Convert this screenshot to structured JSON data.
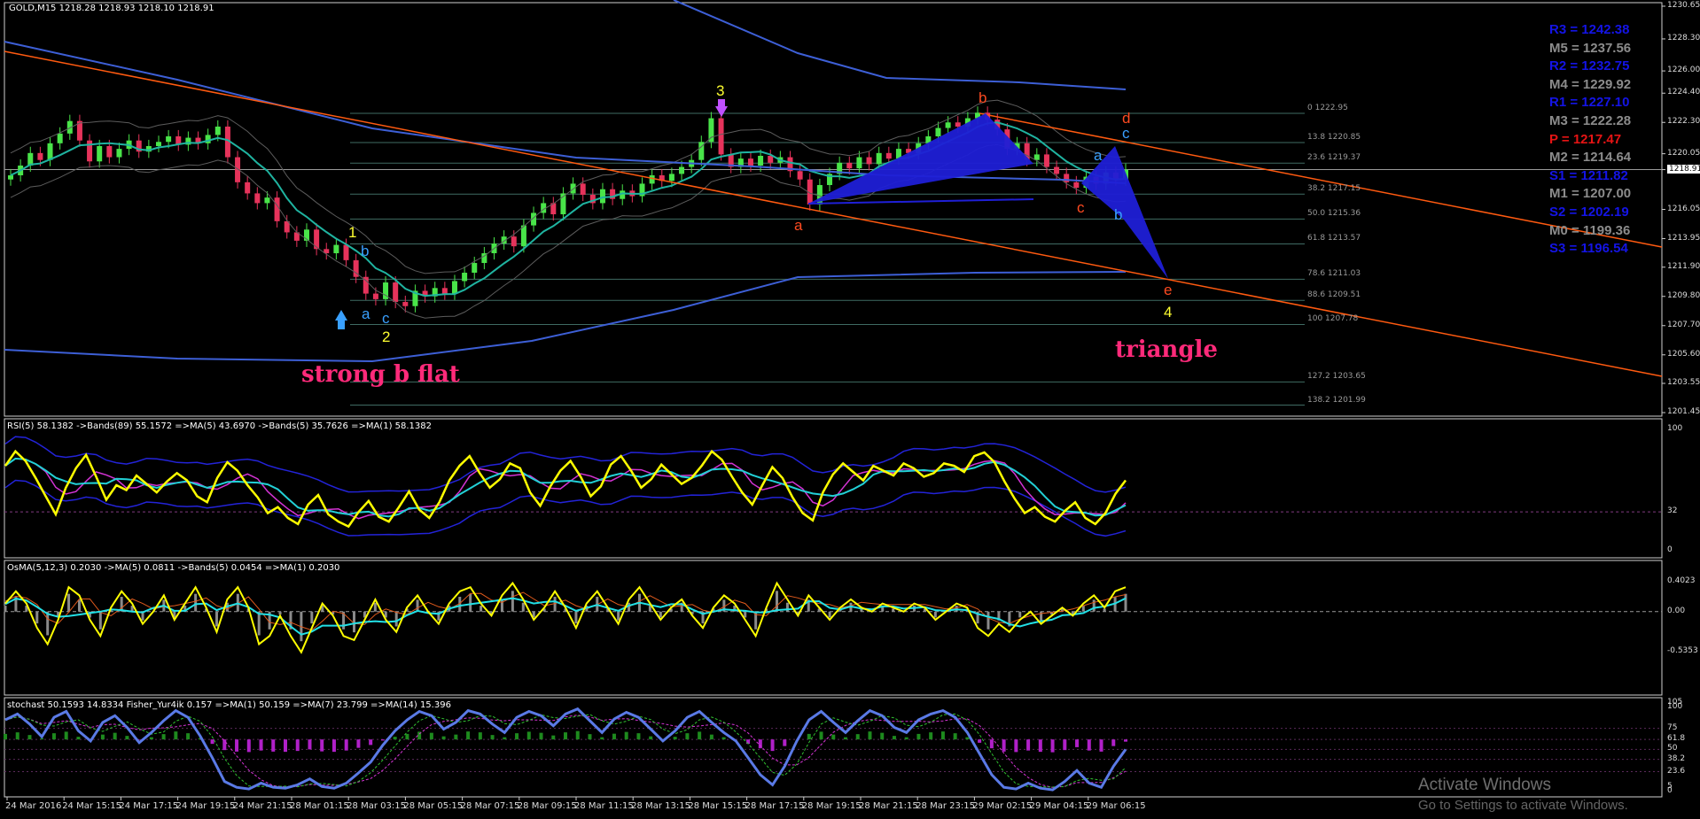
{
  "chart_data": {
    "type": "line",
    "symbol": "GOLD,M15",
    "header_prices": "1218.28 1218.93 1218.10 1218.91",
    "current_price": "1218.91",
    "price_axis": [
      "1230.65",
      "1228.30",
      "1226.00",
      "1224.40",
      "1222.30",
      "1220.05",
      "1218.91",
      "1216.05",
      "1213.95",
      "1211.90",
      "1209.80",
      "1207.70",
      "1205.60",
      "1203.55",
      "1201.45"
    ],
    "ylim": [
      1201.45,
      1230.65
    ],
    "time_labels": [
      "24 Mar 2016",
      "24 Mar 15:15",
      "24 Mar 17:15",
      "24 Mar 19:15",
      "24 Mar 21:15",
      "28 Mar 01:15",
      "28 Mar 03:15",
      "28 Mar 05:15",
      "28 Mar 07:15",
      "28 Mar 09:15",
      "28 Mar 11:15",
      "28 Mar 13:15",
      "28 Mar 15:15",
      "28 Mar 17:15",
      "28 Mar 19:15",
      "28 Mar 21:15",
      "28 Mar 23:15",
      "29 Mar 02:15",
      "29 Mar 04:15",
      "29 Mar 06:15"
    ],
    "close_series": [
      1218.5,
      1219.2,
      1220.1,
      1219.6,
      1220.8,
      1221.5,
      1222.4,
      1221.0,
      1219.5,
      1220.6,
      1219.8,
      1220.4,
      1221.0,
      1220.2,
      1220.6,
      1220.9,
      1221.3,
      1220.7,
      1221.2,
      1220.8,
      1221.4,
      1222.0,
      1219.8,
      1218.0,
      1217.2,
      1216.5,
      1216.9,
      1215.2,
      1214.4,
      1213.8,
      1214.6,
      1213.2,
      1212.9,
      1213.5,
      1212.4,
      1211.2,
      1210.0,
      1209.6,
      1210.8,
      1209.4,
      1209.1,
      1210.2,
      1209.8,
      1210.4,
      1210.0,
      1210.9,
      1211.5,
      1212.2,
      1212.9,
      1213.6,
      1214.1,
      1213.4,
      1214.9,
      1215.8,
      1216.5,
      1215.7,
      1217.2,
      1217.9,
      1217.1,
      1216.5,
      1217.5,
      1216.8,
      1217.4,
      1217.0,
      1217.9,
      1218.5,
      1218.1,
      1218.6,
      1219.1,
      1219.6,
      1220.9,
      1222.6,
      1220.0,
      1219.1,
      1219.7,
      1219.2,
      1219.9,
      1219.4,
      1219.8,
      1218.8,
      1218.2,
      1216.4,
      1217.8,
      1218.6,
      1219.4,
      1219.0,
      1219.8,
      1219.3,
      1220.1,
      1219.7,
      1220.4,
      1220.1,
      1220.8,
      1221.3,
      1221.9,
      1222.3,
      1222.0,
      1222.6,
      1223.0,
      1222.5,
      1221.8,
      1220.4,
      1220.8,
      1219.6,
      1220.0,
      1219.1,
      1218.6,
      1218.0,
      1217.6,
      1218.4,
      1217.9,
      1218.7,
      1218.2,
      1218.9
    ],
    "pivot_levels": [
      {
        "label": "R3 = 1242.38",
        "color": "#1414e6"
      },
      {
        "label": "M5 = 1237.56",
        "color": "#8c8c8c"
      },
      {
        "label": "R2 = 1232.75",
        "color": "#1414e6"
      },
      {
        "label": "M4 = 1229.92",
        "color": "#8c8c8c"
      },
      {
        "label": "R1 = 1227.10",
        "color": "#1414e6"
      },
      {
        "label": "M3 = 1222.28",
        "color": "#8c8c8c"
      },
      {
        "label": "P   = 1217.47",
        "color": "#e61414"
      },
      {
        "label": "M2 = 1214.64",
        "color": "#8c8c8c"
      },
      {
        "label": "S1 = 1211.82",
        "color": "#1414e6"
      },
      {
        "label": "M1 = 1207.00",
        "color": "#8c8c8c"
      },
      {
        "label": "S2 = 1202.19",
        "color": "#1414e6"
      },
      {
        "label": "M0 = 1199.36",
        "color": "#8c8c8c"
      },
      {
        "label": "S3 = 1196.54",
        "color": "#1414e6"
      }
    ],
    "fib_levels": [
      {
        "label": "0 1222.95",
        "price": 1222.95
      },
      {
        "label": "13.8 1220.85",
        "price": 1220.85
      },
      {
        "label": "23.6 1219.37",
        "price": 1219.37
      },
      {
        "label": "38.2 1217.15",
        "price": 1217.15
      },
      {
        "label": "50.0 1215.36",
        "price": 1215.36
      },
      {
        "label": "61.8 1213.57",
        "price": 1213.57
      },
      {
        "label": "78.6 1211.03",
        "price": 1211.03
      },
      {
        "label": "88.6 1209.51",
        "price": 1209.51
      },
      {
        "label": "100 1207.78",
        "price": 1207.78
      },
      {
        "label": "127.2 1203.65",
        "price": 1203.65
      },
      {
        "label": "138.2 1201.99",
        "price": 1201.99
      }
    ],
    "wave_labels": {
      "w1": "1",
      "w2": "2",
      "w3": "3",
      "w4": "4",
      "lb_b1": "b",
      "lb_a1": "a",
      "lb_c1": "c",
      "lb_a2": "a",
      "lb_b2": "b",
      "lb_c2": "c",
      "lb_d2": "d",
      "lb_e2": "e",
      "lb_a3": "a",
      "lb_b3": "b",
      "lb_c3": "c"
    },
    "annotations": {
      "flat": "strong b flat",
      "triangle": "triangle"
    },
    "indicators": {
      "rsi_header": "RSI(5) 58.1382  ->Bands(89) 55.1572  =>MA(5) 43.6970  ->Bands(5) 35.7626  =>MA(1) 58.1382",
      "rsi_axis": [
        "100",
        "32",
        "0"
      ],
      "rsi_values": [
        70,
        82,
        74,
        60,
        45,
        30,
        52,
        68,
        79,
        61,
        42,
        54,
        50,
        62,
        55,
        48,
        57,
        64,
        58,
        45,
        40,
        60,
        73,
        66,
        54,
        44,
        31,
        36,
        27,
        22,
        38,
        46,
        30,
        24,
        20,
        32,
        41,
        28,
        24,
        36,
        49,
        34,
        27,
        40,
        58,
        70,
        78,
        64,
        52,
        59,
        72,
        68,
        48,
        37,
        53,
        66,
        74,
        61,
        45,
        53,
        71,
        78,
        66,
        52,
        59,
        71,
        63,
        55,
        60,
        70,
        82,
        75,
        61,
        48,
        38,
        54,
        69,
        60,
        44,
        31,
        25,
        48,
        63,
        72,
        65,
        58,
        70,
        66,
        62,
        72,
        68,
        61,
        64,
        72,
        70,
        65,
        78,
        81,
        73,
        57,
        43,
        31,
        36,
        28,
        24,
        33,
        40,
        27,
        22,
        31,
        47,
        58
      ],
      "osma_header": "OsMA(5,12,3) 0.2030  ->MA(5) 0.0811  ->Bands(5) 0.0454  =>MA(1) 0.2030",
      "osma_axis": [
        "0.4023",
        "0.00",
        "-0.5353"
      ],
      "osma_values": [
        0.1,
        0.25,
        0.1,
        -0.2,
        -0.4,
        -0.1,
        0.3,
        0.2,
        -0.1,
        -0.3,
        0.05,
        0.25,
        0.1,
        -0.15,
        0.0,
        0.2,
        -0.1,
        0.1,
        0.3,
        0.05,
        -0.25,
        0.15,
        0.3,
        0.05,
        -0.4,
        -0.3,
        -0.05,
        -0.3,
        -0.5,
        -0.2,
        0.1,
        -0.05,
        -0.3,
        -0.35,
        -0.1,
        0.15,
        -0.1,
        -0.25,
        0.05,
        0.2,
        0.0,
        -0.15,
        0.1,
        0.25,
        0.3,
        0.1,
        -0.05,
        0.2,
        0.35,
        0.15,
        -0.1,
        0.05,
        0.25,
        0.05,
        -0.2,
        0.1,
        0.25,
        0.05,
        -0.15,
        0.15,
        0.3,
        0.1,
        -0.1,
        0.05,
        0.15,
        -0.05,
        -0.2,
        0.05,
        0.2,
        0.1,
        -0.1,
        -0.3,
        0.05,
        0.35,
        0.15,
        -0.05,
        0.2,
        0.05,
        -0.1,
        0.05,
        0.15,
        0.05,
        0.0,
        0.1,
        0.05,
        0.0,
        0.1,
        0.05,
        -0.1,
        0.0,
        0.1,
        0.05,
        -0.2,
        -0.3,
        -0.15,
        -0.25,
        -0.1,
        0.0,
        -0.15,
        -0.05,
        0.05,
        -0.05,
        0.1,
        0.2,
        0.05,
        0.25,
        0.3
      ],
      "stoch_header": "stochast 50.1593 14.8334  Fisher_Yur4ik 0.157  =>MA(1) 50.159  =>MA(7) 23.799  =>MA(14) 15.396",
      "stoch_axis": [
        "105",
        "100",
        "75",
        "61.8",
        "50",
        "38.2",
        "23.6",
        "5",
        "0"
      ],
      "stoch_values": [
        85,
        92,
        80,
        65,
        88,
        95,
        72,
        60,
        82,
        90,
        76,
        58,
        70,
        84,
        96,
        88,
        66,
        40,
        12,
        5,
        3,
        10,
        5,
        4,
        8,
        15,
        6,
        4,
        10,
        22,
        35,
        55,
        72,
        85,
        95,
        90,
        74,
        82,
        96,
        92,
        80,
        70,
        88,
        95,
        90,
        78,
        92,
        98,
        84,
        70,
        86,
        94,
        88,
        74,
        60,
        72,
        88,
        95,
        82,
        70,
        60,
        40,
        20,
        8,
        30,
        60,
        85,
        95,
        82,
        70,
        84,
        96,
        90,
        76,
        70,
        85,
        92,
        96,
        88,
        70,
        45,
        20,
        5,
        3,
        10,
        4,
        2,
        12,
        25,
        10,
        5,
        30,
        50
      ]
    }
  },
  "watermark": {
    "line1": "Activate Windows",
    "line2": "Go to Settings to activate Windows."
  }
}
